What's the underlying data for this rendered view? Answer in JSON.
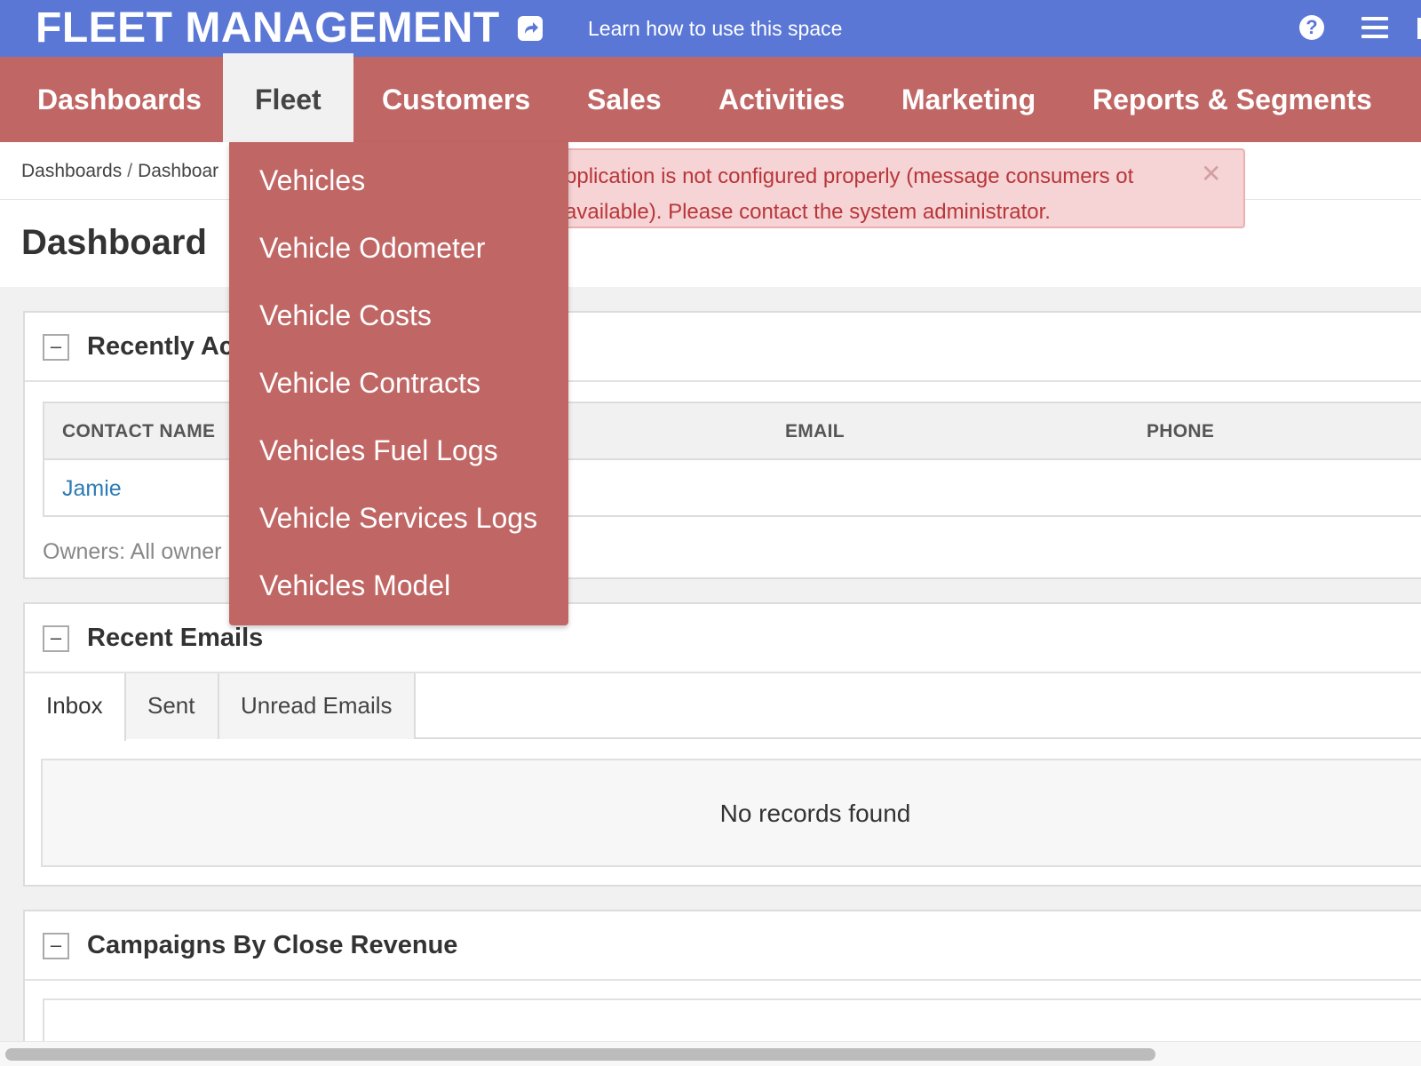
{
  "topbar": {
    "app_title": "FLEET MANAGEMENT",
    "share_icon": "share-icon",
    "learn_link": "Learn how to use this space",
    "help_icon": "help-icon",
    "menu_icon": "hamburger-icon",
    "brand_color": "#5a77d6"
  },
  "nav": {
    "accent_color": "#c06765",
    "items": [
      "Dashboards",
      "Fleet",
      "Customers",
      "Sales",
      "Activities",
      "Marketing",
      "Reports & Segments"
    ],
    "active": "Fleet"
  },
  "breadcrumb": {
    "items": [
      "Dashboards",
      "Dashboar"
    ],
    "separator": "/"
  },
  "page": {
    "title": "Dashboard"
  },
  "alert": {
    "text": "pplication is not configured properly (message consumers ot available). Please contact the system administrator.",
    "close_icon": "close-icon",
    "color": "#b8363a"
  },
  "panels": {
    "recently": {
      "title": "Recently Ac",
      "collapse": "–",
      "columns": [
        "CONTACT NAME",
        "EMAIL",
        "PHONE"
      ],
      "rows": [
        {
          "contact_name": "Jamie",
          "email": "",
          "phone": ""
        }
      ],
      "owners": "Owners: All owner"
    },
    "emails": {
      "title": "Recent Emails",
      "collapse": "–",
      "tabs": [
        "Inbox",
        "Sent",
        "Unread Emails"
      ],
      "active_tab": "Inbox",
      "empty": "No records found"
    },
    "campaigns": {
      "title": "Campaigns By Close Revenue",
      "collapse": "–"
    }
  },
  "dropdown": {
    "items": [
      "Vehicles",
      "Vehicle Odometer",
      "Vehicle Costs",
      "Vehicle Contracts",
      "Vehicles Fuel Logs",
      "Vehicle Services Logs",
      "Vehicles Model"
    ]
  },
  "scrollbar": {
    "position": 0.0,
    "visible_fraction": 0.81
  }
}
